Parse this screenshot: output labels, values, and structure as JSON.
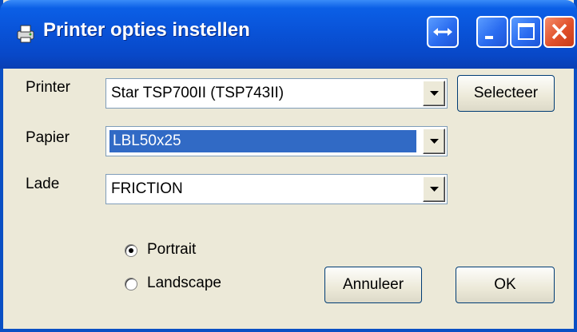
{
  "window": {
    "title": "Printer opties instellen"
  },
  "titlebar_buttons": {
    "resize": "resize-icon",
    "minimize": "minimize-icon",
    "maximize": "maximize-icon",
    "close": "close-icon"
  },
  "form": {
    "printer": {
      "label": "Printer",
      "value": "Star TSP700II (TSP743II)"
    },
    "papier": {
      "label": "Papier",
      "value": "LBL50x25"
    },
    "lade": {
      "label": "Lade",
      "value": "FRICTION"
    },
    "select_button": "Selecteer"
  },
  "orientation": {
    "options": [
      "Portrait",
      "Landscape"
    ],
    "selected": "Portrait"
  },
  "buttons": {
    "cancel": "Annuleer",
    "ok": "OK"
  },
  "colors": {
    "titlebar": "#0953d8",
    "selection": "#316ac5",
    "face": "#ece9d8"
  }
}
